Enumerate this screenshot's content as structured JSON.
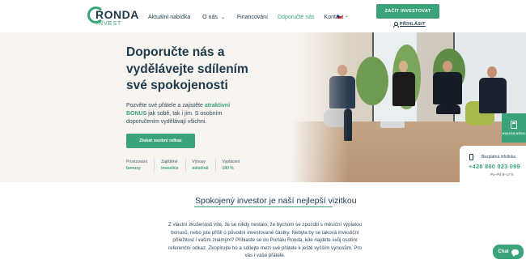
{
  "brand": {
    "name": "RONDA",
    "sub": "INVEST",
    "accent": "#3aa37a",
    "navy": "#1d3a4c"
  },
  "nav": [
    {
      "label": "Aktuální nabídka",
      "dropdown": false,
      "active": false
    },
    {
      "label": "O nás",
      "dropdown": true,
      "active": false
    },
    {
      "label": "Financování",
      "dropdown": false,
      "active": false
    },
    {
      "label": "Doporučte nás",
      "dropdown": false,
      "active": true
    },
    {
      "label": "Kontakt",
      "dropdown": false,
      "active": false
    }
  ],
  "language": {
    "flag": "cz-flag-icon"
  },
  "header": {
    "cta": "ZAČÍT INVESTOVAT",
    "login": "PŘIHLÁSIT"
  },
  "hero": {
    "title": "Doporučte nás a vydělávejte sdílením své spokojenosti",
    "text_before": "Pozvěte své přátele a zajistěte ",
    "text_highlight": "atraktivní BONUS",
    "text_after": " jak sobě, tak i jim. S osobním doporučením vydělávají všichni.",
    "button": "Získat osobní odkaz",
    "features": [
      {
        "title": "Provizování",
        "value": "bonusy"
      },
      {
        "title": "Zajištěné",
        "value": "investice"
      },
      {
        "title": "Výnosy",
        "value": "měsíčně"
      },
      {
        "title": "Vyplácení",
        "value": "100 %"
      }
    ]
  },
  "widgets": {
    "calculator": "KALKULAČKA",
    "info_title": "Bezplatná infolinka",
    "phone": "+420 800 023 099",
    "hours": "Po–Pá   9–17 h"
  },
  "section": {
    "title": "Spokojený investor je naší nejlepší vizitkou",
    "paragraph": "Z vlastní zkušenosti víte, že se nikdy nestalo, že bychom se zpozdili s měsíční výplatou bonusů, nebo jste přišli o původní investované částky. Nebyla by se taková investiční příležitost i vašim známým? Přihlaste se do Portálu Ronda, kde najdete svůj osobní referenční odkaz. Zkopírujte ho a sdílejte mezi své přátele k ještě vyšším výnosům. Pro vás i vaše přátele."
  },
  "chat": {
    "label": "Chat"
  }
}
